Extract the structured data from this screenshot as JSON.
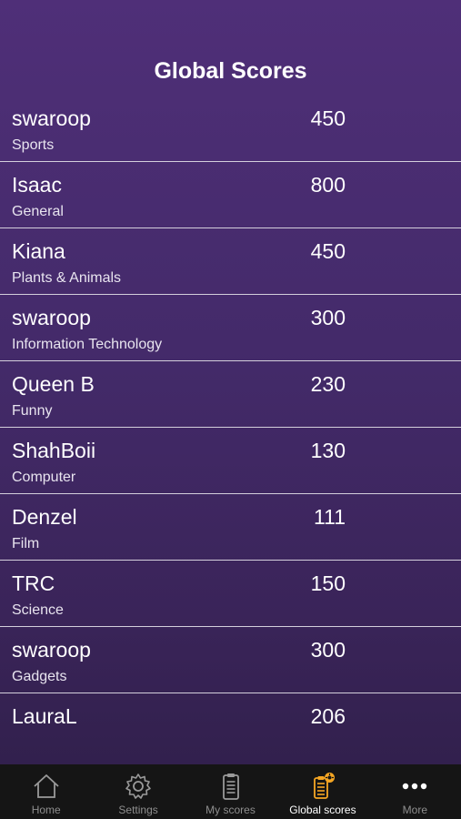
{
  "header": {
    "title": "Global Scores"
  },
  "scores": [
    {
      "name": "swaroop",
      "category": "Sports",
      "score": "450"
    },
    {
      "name": "Isaac",
      "category": "General",
      "score": "800"
    },
    {
      "name": "Kiana",
      "category": "Plants & Animals",
      "score": "450"
    },
    {
      "name": "swaroop",
      "category": "Information Technology",
      "score": "300"
    },
    {
      "name": "Queen B",
      "category": "Funny",
      "score": "230"
    },
    {
      "name": "ShahBoii",
      "category": "Computer",
      "score": "130"
    },
    {
      "name": "Denzel",
      "category": "Film",
      "score": "111"
    },
    {
      "name": "TRC",
      "category": "Science",
      "score": "150"
    },
    {
      "name": "swaroop",
      "category": "Gadgets",
      "score": "300"
    },
    {
      "name": "LauraL",
      "category": "",
      "score": "206"
    }
  ],
  "tabbar": {
    "tabs": [
      {
        "label": "Home",
        "icon": "home-icon"
      },
      {
        "label": "Settings",
        "icon": "gear-icon"
      },
      {
        "label": "My scores",
        "icon": "clipboard-icon"
      },
      {
        "label": "Global scores",
        "icon": "clipboard-badge-icon",
        "active": true
      },
      {
        "label": "More",
        "icon": "more-icon"
      }
    ]
  },
  "colors": {
    "active_icon": "#f5a623",
    "inactive_icon": "#9a9a9a",
    "divider": "#d4cfdc"
  }
}
